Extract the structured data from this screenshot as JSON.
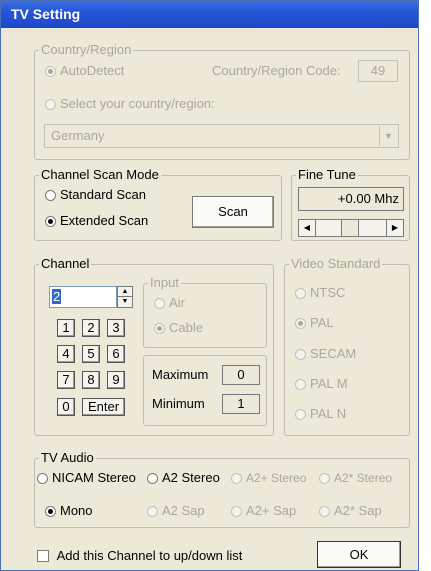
{
  "window": {
    "title": "TV Setting"
  },
  "country_region": {
    "legend": "Country/Region",
    "autodetect_label": "AutoDetect",
    "code_label": "Country/Region Code:",
    "code_value": "49",
    "select_label": "Select your country/region:",
    "country_selected": "Germany"
  },
  "channel_scan_mode": {
    "legend": "Channel Scan Mode",
    "standard_label": "Standard Scan",
    "extended_label": "Extended Scan",
    "scan_button": "Scan"
  },
  "fine_tune": {
    "legend": "Fine Tune",
    "value": "+0.00 Mhz"
  },
  "channel": {
    "legend": "Channel",
    "value": "2",
    "keys": [
      "1",
      "2",
      "3",
      "4",
      "5",
      "6",
      "7",
      "8",
      "9",
      "0"
    ],
    "enter_label": "Enter",
    "input": {
      "legend": "Input",
      "air_label": "Air",
      "cable_label": "Cable"
    },
    "maximum_label": "Maximum",
    "maximum_value": "0",
    "minimum_label": "Minimum",
    "minimum_value": "1"
  },
  "video_standard": {
    "legend": "Video Standard",
    "options": [
      "NTSC",
      "PAL",
      "SECAM",
      "PAL M",
      "PAL N"
    ],
    "selected": "PAL"
  },
  "tv_audio": {
    "legend": "TV Audio",
    "nicam_stereo": "NICAM Stereo",
    "a2_stereo": "A2 Stereo",
    "a2plus_stereo": "A2+ Stereo",
    "a2star_stereo": "A2* Stereo",
    "mono": "Mono",
    "a2_sap": "A2 Sap",
    "a2plus_sap": "A2+ Sap",
    "a2star_sap": "A2* Sap"
  },
  "footer": {
    "add_channel_label": "Add this Channel to up/down list",
    "ok_button": "OK"
  },
  "colors": {
    "titlebar": "#2456d8",
    "window_bg": "#ece9d8",
    "disabled_text": "#aca899"
  }
}
